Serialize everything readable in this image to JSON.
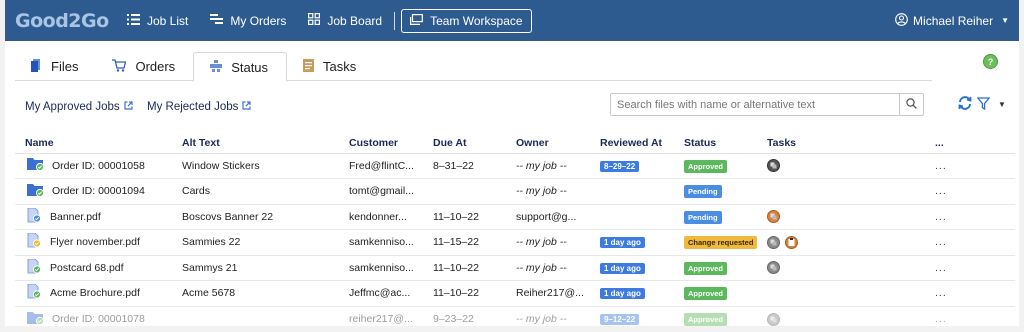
{
  "brand": "Good2Go",
  "nav": {
    "items": [
      {
        "label": "Job List",
        "icon": "list-icon"
      },
      {
        "label": "My Orders",
        "icon": "orders-icon"
      },
      {
        "label": "Job Board",
        "icon": "grid-icon"
      },
      {
        "label": "Team Workspace",
        "icon": "workspace-icon"
      }
    ],
    "user": "Michael Reiher"
  },
  "tabs": [
    {
      "label": "Files",
      "icon": "files-icon"
    },
    {
      "label": "Orders",
      "icon": "cart-icon"
    },
    {
      "label": "Status",
      "icon": "status-icon",
      "active": true
    },
    {
      "label": "Tasks",
      "icon": "tasks-icon"
    }
  ],
  "help": "?",
  "filters": {
    "approved": "My Approved Jobs",
    "rejected": "My Rejected Jobs",
    "search_placeholder": "Search files with name or alternative text"
  },
  "table": {
    "columns": [
      "Name",
      "Alt Text",
      "Customer",
      "Due At",
      "Owner",
      "Reviewed At",
      "Status",
      "Tasks",
      "..."
    ],
    "rows": [
      {
        "name": "Order ID: 00001058",
        "type": "order",
        "alt": "Window Stickers",
        "customer": "Fred@flintC...",
        "due": "8–31–22",
        "owner": "-- my job --",
        "owner_mine": true,
        "reviewed": "8–29–22",
        "status": "Approved",
        "tasks": [
          "dark"
        ],
        "more": "..."
      },
      {
        "name": "Order ID: 00001094",
        "type": "order",
        "alt": "Cards",
        "customer": "tomt@gmail...",
        "due": "",
        "owner": "-- my job --",
        "owner_mine": true,
        "reviewed": "",
        "status": "Pending",
        "tasks": [],
        "more": "..."
      },
      {
        "name": "Banner.pdf",
        "type": "file-pending",
        "alt": "Boscovs Banner 22",
        "customer": "kendonner...",
        "due": "11–10–22",
        "owner": "support@g...",
        "owner_mine": false,
        "reviewed": "",
        "status": "Pending",
        "tasks": [
          "orange"
        ],
        "more": "..."
      },
      {
        "name": "Flyer november.pdf",
        "type": "file-change",
        "alt": "Sammies 22",
        "customer": "samkenniso...",
        "due": "11–15–22",
        "owner": "-- my job --",
        "owner_mine": true,
        "reviewed": "1 day ago",
        "status": "Change requested",
        "tasks": [
          "gray",
          "orange-clip"
        ],
        "more": "..."
      },
      {
        "name": "Postcard 68.pdf",
        "type": "file-approved",
        "alt": "Sammys 21",
        "customer": "samkenniso...",
        "due": "11–10–22",
        "owner": "-- my job --",
        "owner_mine": true,
        "reviewed": "1 day ago",
        "status": "Approved",
        "tasks": [
          "gray"
        ],
        "more": "..."
      },
      {
        "name": "Acme Brochure.pdf",
        "type": "file-approved",
        "alt": "Acme 5678",
        "customer": "Jeffmc@ac...",
        "due": "11–10–22",
        "owner": "Reiher217@...",
        "owner_mine": false,
        "reviewed": "1 day ago",
        "status": "Approved",
        "tasks": [],
        "more": "..."
      },
      {
        "name": "Order ID: 00001078",
        "type": "order",
        "alt": "",
        "customer": "reiher217@...",
        "due": "9–23–22",
        "owner": "-- my job --",
        "owner_mine": true,
        "reviewed": "9–12–22",
        "status": "Approved",
        "tasks": [
          "gray"
        ],
        "more": "...",
        "fade": true
      }
    ]
  },
  "colors": {
    "nav": "#2e5b8f",
    "approved": "#5cb85c",
    "pending": "#4b8de0",
    "change": "#f0b93c",
    "date": "#3d7be0"
  }
}
